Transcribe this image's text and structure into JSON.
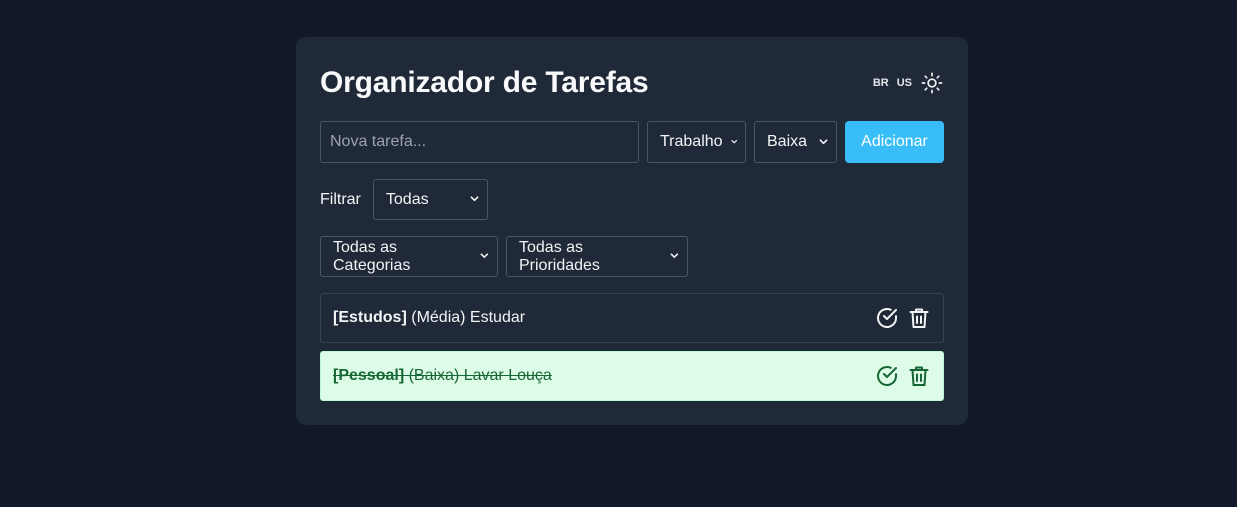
{
  "header": {
    "title": "Organizador de Tarefas",
    "lang_br": "BR",
    "lang_us": "US",
    "theme_icon": "sun-icon"
  },
  "add_form": {
    "input_placeholder": "Nova tarefa...",
    "input_value": "",
    "category_selected": "Trabalho",
    "priority_selected": "Baixa",
    "add_label": "Adicionar"
  },
  "filter": {
    "label": "Filtrar",
    "status_selected": "Todas",
    "category_selected": "Todas as Categorias",
    "priority_selected": "Todas as Prioridades"
  },
  "tasks": [
    {
      "category": "[Estudos]",
      "priority": "(Média)",
      "text": "Estudar",
      "done": false
    },
    {
      "category": "[Pessoal]",
      "priority": "(Baixa)",
      "text": "Lavar Louça",
      "done": true
    }
  ],
  "colors": {
    "background": "#111827",
    "card": "#1f2937",
    "accent": "#38bdf8",
    "done_bg": "#dcfce7",
    "done_text": "#166534"
  }
}
